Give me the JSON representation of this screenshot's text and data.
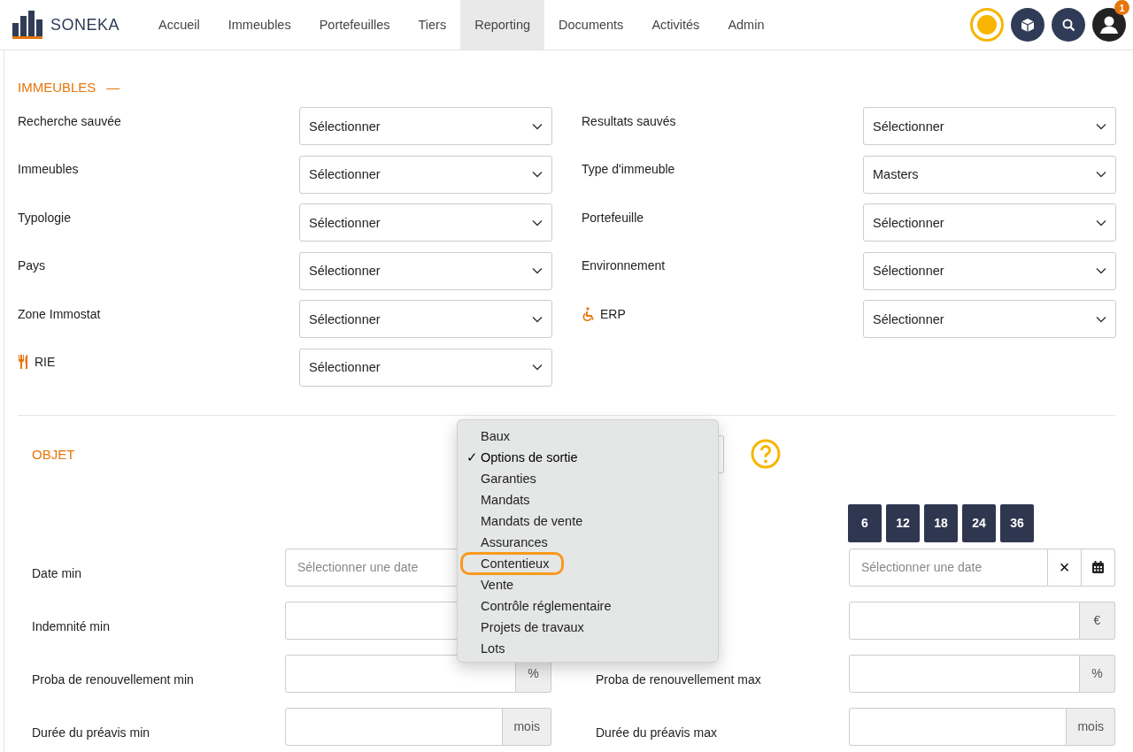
{
  "nav": {
    "brand": "SONEKA",
    "items": [
      {
        "label": "Accueil",
        "selected": false
      },
      {
        "label": "Immeubles",
        "selected": false
      },
      {
        "label": "Portefeuilles",
        "selected": false
      },
      {
        "label": "Tiers",
        "selected": false
      },
      {
        "label": "Reporting",
        "selected": true
      },
      {
        "label": "Documents",
        "selected": false
      },
      {
        "label": "Activités",
        "selected": false
      },
      {
        "label": "Admin",
        "selected": false
      }
    ],
    "notification_count": "1"
  },
  "immeubles": {
    "title": "IMMEUBLES",
    "collapse_symbol": "—",
    "left": [
      {
        "label": "Recherche sauvée",
        "value": "Sélectionner",
        "kind": "plain"
      },
      {
        "label": "Immeubles",
        "value": "Sélectionner",
        "kind": "plain"
      },
      {
        "label": "Typologie",
        "value": "Sélectionner",
        "kind": "plain"
      },
      {
        "label": "Pays",
        "value": "Sélectionner",
        "kind": "plain"
      },
      {
        "label": "Zone Immostat",
        "value": "Sélectionner",
        "kind": "plain"
      },
      {
        "label": "RIE",
        "value": "Sélectionner",
        "kind": "restaurant"
      }
    ],
    "right": [
      {
        "label": "Resultats sauvés",
        "value": "Sélectionner",
        "kind": "plain"
      },
      {
        "label": "Type d'immeuble",
        "value": "Masters",
        "kind": "plain"
      },
      {
        "label": "Portefeuille",
        "value": "Sélectionner",
        "kind": "plain"
      },
      {
        "label": "Environnement",
        "value": "Sélectionner",
        "kind": "plain"
      },
      {
        "label": "ERP",
        "value": "Sélectionner",
        "kind": "accessibility"
      }
    ]
  },
  "objet": {
    "title": "OBJET",
    "period_buttons": [
      "6",
      "12",
      "18",
      "24",
      "36"
    ],
    "left": [
      {
        "label": "Date min",
        "kind": "date",
        "placeholder": "Sélectionner une date"
      },
      {
        "label": "Indemnité min",
        "kind": "text"
      },
      {
        "label": "Proba de renouvellement min",
        "kind": "suffix",
        "suffix": "%"
      },
      {
        "label": "Durée du préavis min",
        "kind": "suffix",
        "suffix": "mois"
      }
    ],
    "right": [
      {
        "kind": "date",
        "placeholder": "Sélectionner une date",
        "clear": "×"
      },
      {
        "kind": "suffix",
        "suffix": "€"
      },
      {
        "label": "Proba de renouvellement max",
        "kind": "suffix",
        "suffix": "%"
      },
      {
        "label": "Durée du préavis max",
        "kind": "suffix",
        "suffix": "mois"
      }
    ]
  },
  "dropdown": {
    "options": [
      {
        "label": "Baux",
        "selected": false,
        "highlighted": false
      },
      {
        "label": "Options de sortie",
        "selected": true,
        "highlighted": false
      },
      {
        "label": "Garanties",
        "selected": false,
        "highlighted": false
      },
      {
        "label": "Mandats",
        "selected": false,
        "highlighted": false
      },
      {
        "label": "Mandats de vente",
        "selected": false,
        "highlighted": false
      },
      {
        "label": "Assurances",
        "selected": false,
        "highlighted": false
      },
      {
        "label": "Contentieux",
        "selected": false,
        "highlighted": true
      },
      {
        "label": "Vente",
        "selected": false,
        "highlighted": false
      },
      {
        "label": "Contrôle réglementaire",
        "selected": false,
        "highlighted": false
      },
      {
        "label": "Projets de travaux",
        "selected": false,
        "highlighted": false
      },
      {
        "label": "Lots",
        "selected": false,
        "highlighted": false
      }
    ],
    "check_symbol": "✓"
  }
}
